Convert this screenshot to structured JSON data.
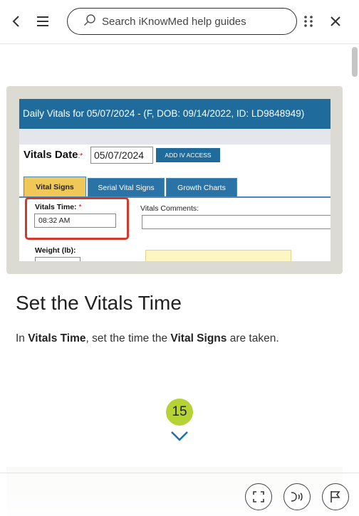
{
  "header": {
    "back_icon": "chevron-left-icon",
    "menu_icon": "hamburger-menu-icon",
    "search_placeholder": "Search iKnowMed help guides",
    "drag_icon": "drag-handle-icon",
    "close_icon": "close-icon"
  },
  "screenshot": {
    "window_title": "Daily Vitals for 05/07/2024 - (F, DOB: 09/14/2022, ID: LD9848949)",
    "vitals_date_label": "Vitals Date",
    "vitals_date_value": "05/07/2024",
    "add_iv_button": "ADD IV ACCESS",
    "tabs": [
      "Vital Signs",
      "Serial Vital Signs",
      "Growth Charts"
    ],
    "vitals_time_label": "Vitals Time:",
    "vitals_time_value": "08:32 AM",
    "vitals_comments_label": "Vitals Comments:",
    "weight_label": "Weight (lb):"
  },
  "step": {
    "title": "Set the Vitals Time",
    "text_parts": [
      "In ",
      "Vitals Time",
      ", set the time the ",
      "Vital Signs",
      " are taken."
    ],
    "number": "15"
  },
  "footer": {
    "buttons": [
      "fullscreen-icon",
      "read-aloud-icon",
      "flag-icon"
    ]
  },
  "colors": {
    "accent": "#b5d334",
    "arrow": "#1e6fa8",
    "highlight": "#d0392b",
    "screenshot_header": "#1e6b9c"
  }
}
